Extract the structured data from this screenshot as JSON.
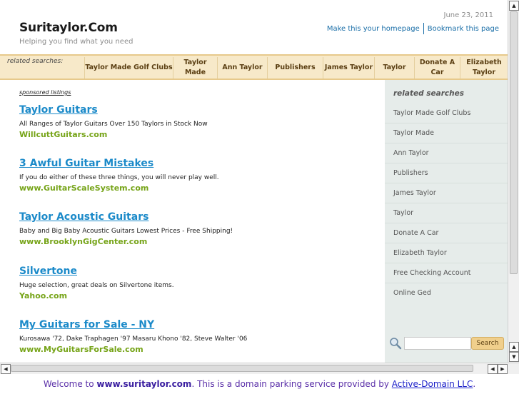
{
  "header": {
    "site_title": "Suritaylor.Com",
    "tagline": "Helping you find what you need",
    "date": "June 23, 2011",
    "homepage_link": "Make this your homepage",
    "bookmark_link": "Bookmark this page"
  },
  "related_bar": {
    "label": "related searches:",
    "items": [
      "Taylor Made Golf Clubs",
      "Taylor Made",
      "Ann Taylor",
      "Publishers",
      "James Taylor",
      "Taylor",
      "Donate A Car",
      "Elizabeth Taylor"
    ]
  },
  "main": {
    "sponsored_label": "sponsored listings",
    "listings": [
      {
        "title": "Taylor Guitars",
        "desc": "All Ranges of Taylor Guitars Over 150 Taylors in Stock Now",
        "url": "WillcuttGuitars.com"
      },
      {
        "title": "3 Awful Guitar Mistakes",
        "desc": "If you do either of these three things, you will never play well.",
        "url": "www.GuitarScaleSystem.com"
      },
      {
        "title": "Taylor Acoustic Guitars",
        "desc": "Baby and Big Baby Acoustic Guitars Lowest Prices - Free Shipping!",
        "url": "www.BrooklynGigCenter.com"
      },
      {
        "title": "Silvertone",
        "desc": "Huge selection, great deals on Silvertone items.",
        "url": "Yahoo.com"
      },
      {
        "title": "My Guitars for Sale - NY",
        "desc": "Kurosawa '72, Dake Traphagen '97 Masaru Khono '82, Steve Walter '06",
        "url": "www.MyGuitarsForSale.com"
      }
    ]
  },
  "sidebar": {
    "heading": "related searches",
    "items": [
      "Taylor Made Golf Clubs",
      "Taylor Made",
      "Ann Taylor",
      "Publishers",
      "James Taylor",
      "Taylor",
      "Donate A Car",
      "Elizabeth Taylor",
      "Free Checking Account",
      "Online Ged"
    ],
    "search_placeholder": "",
    "search_button": "Search"
  },
  "footer": {
    "prefix": "Welcome to ",
    "domain": "www.suritaylor.com",
    "middle": ". This is a domain parking service provided by ",
    "provider": "Active-Domain LLC",
    "suffix": "."
  },
  "colors": {
    "link_blue": "#1b8ac9",
    "url_green": "#76a418",
    "bar_bg": "#f7e9c9",
    "sidebar_bg": "#e6ecea",
    "footer_purple": "#5a2fa8"
  }
}
